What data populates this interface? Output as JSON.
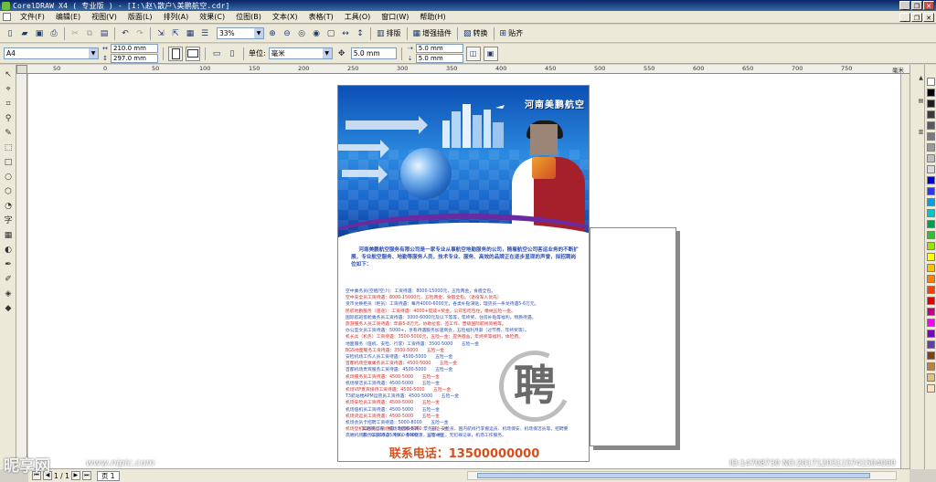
{
  "titlebar": {
    "title": "CorelDRAW X4 ( 专业版 ) - [I:\\赵\\散户\\美鹏航空.cdr]",
    "minimize": "_",
    "restore": "❐",
    "close": "✕"
  },
  "menu": {
    "items": [
      "文件(F)",
      "编辑(E)",
      "视图(V)",
      "版面(L)",
      "排列(A)",
      "效果(C)",
      "位图(B)",
      "文本(X)",
      "表格(T)",
      "工具(O)",
      "窗口(W)",
      "帮助(H)"
    ]
  },
  "toolbar": {
    "zoom": "33%",
    "arrange_label": "排版",
    "enhance_label": "增强插件",
    "convert_label": "转换",
    "snap_label": "贴齐"
  },
  "property_bar": {
    "paper_size": "A4",
    "width": "210.0 mm",
    "height": "297.0 mm",
    "unit_label": "单位:",
    "unit": "毫米",
    "nudge": "5.0 mm",
    "dup_x": "5.0 mm",
    "dup_y": "5.0 mm"
  },
  "ruler": {
    "ticks": [
      "50",
      "0",
      "50",
      "100",
      "150",
      "200",
      "250",
      "300",
      "350",
      "400",
      "450",
      "500",
      "550",
      "600",
      "650",
      "700",
      "750",
      "毫米"
    ]
  },
  "poster": {
    "brand": "河南美鹏航空",
    "intro": "河南美鹏航空服务有限公司是一家专业从事航空地勤服务的公司，随着航空公司客运业务的不断扩展，专业航空服务、地勤等服务人员，技术专业、服务、高效的品牌正在逐步显现的声誉，拟招聘岗位如下：",
    "jobs": [
      "空中乘务员(空姐/空少)：工资待遇：8000-15000元，五险两金，食宿全包。",
      "空中安全员工资待遇：8000-15000元，五险两金，食宿全包。（退役军人优先）",
      "货币兑换柜员（柜员）工资待遇：每月4000-6000元，各类补贴津贴，理货员一条龙待遇5-6万元。",
      "民航地勤服务（速递）：工资待遇：4000+提成+奖金，公司包吃包住，缴纳五险一金。",
      "国际航班客舱乘务员工资待遇：3000-6000元及以下等等，年终奖、住房补贴等福利，物质待遇。",
      "旅游服务人员工资待遇：年薪5-8万元，协助拉客、签工作、晋级国际航线资格等。",
      "办公室文员工资待遇：5000+，享有待遇服务加速商会，五险福利月薪（过节费、年终奖等）。",
      "机长兵（机务）工资待遇：3500-5000元，五险一金；提供宿舍，年终奖等福利，体检费。",
      "地面服务（值机、安检、行李）工资待遇：3500-5000　　五险一金",
      "BGS地面服务工资待遇：3500-5000　　五险一金",
      "安检机场工作人员工资待遇：4500-5000　　五险一金",
      "首都机场空乘乘务员工资待遇：4500-5000　　五险一金",
      "首都机场贵宾服务工资待遇：4500-5000　　五险一金",
      "机场服务员工资待遇：4500-5000　　五险一金",
      "机场保洁员工资待遇：4500-5000　　五险一金",
      "机场VIP贵宾接待工资待遇：4500-5000　　五险一金",
      "T3航站楼APM运营员工资待遇：4500-5000　　五险一金",
      "机场安检员工资待遇：4500-5000　　五险一金",
      "机场值机员工资待遇：4500-5000　　五险一金",
      "机场货运员工资待遇：4500-5000　　五险一金",
      "机场会员卡招聘工资待遇：5000-8000　　五险一金",
      "机场登机口服务工资待遇：5000-8000　　五险一金",
      "高端机场服务工资待遇：4000-5000　　五险一金"
    ],
    "seal_char": "聘",
    "benefits": "其他岗位有：机场地面服务商、票务员、安检员、国内航线行李搬运员、机场保安、机场保洁员等。招聘要求：年龄18-35周岁，身体健康，五官端正，无犯罪记录，机场工作服务。",
    "phone": "联系电话：13500000000"
  },
  "status": {
    "page_count": "1 / 1",
    "page_tab": "页 1"
  },
  "watermark": {
    "site": "昵享网",
    "url": "www.nipic.com",
    "id": "ID:14708730 NO:20171203115741504000"
  },
  "palette": [
    "#ffffff",
    "#000000",
    "#1f1f1f",
    "#3a3a3a",
    "#5a5a5a",
    "#7a7a7a",
    "#9a9a9a",
    "#bdbdbd",
    "#d9d9d9",
    "#0000c8",
    "#3030ff",
    "#00a0e0",
    "#00c8c8",
    "#00a050",
    "#30c030",
    "#a0e000",
    "#ffff00",
    "#ffc000",
    "#ff8000",
    "#ff4000",
    "#e00000",
    "#c00080",
    "#ff00ff",
    "#8000c0",
    "#6040a0",
    "#804020",
    "#c08040",
    "#e0c080",
    "#ffe0c0"
  ]
}
